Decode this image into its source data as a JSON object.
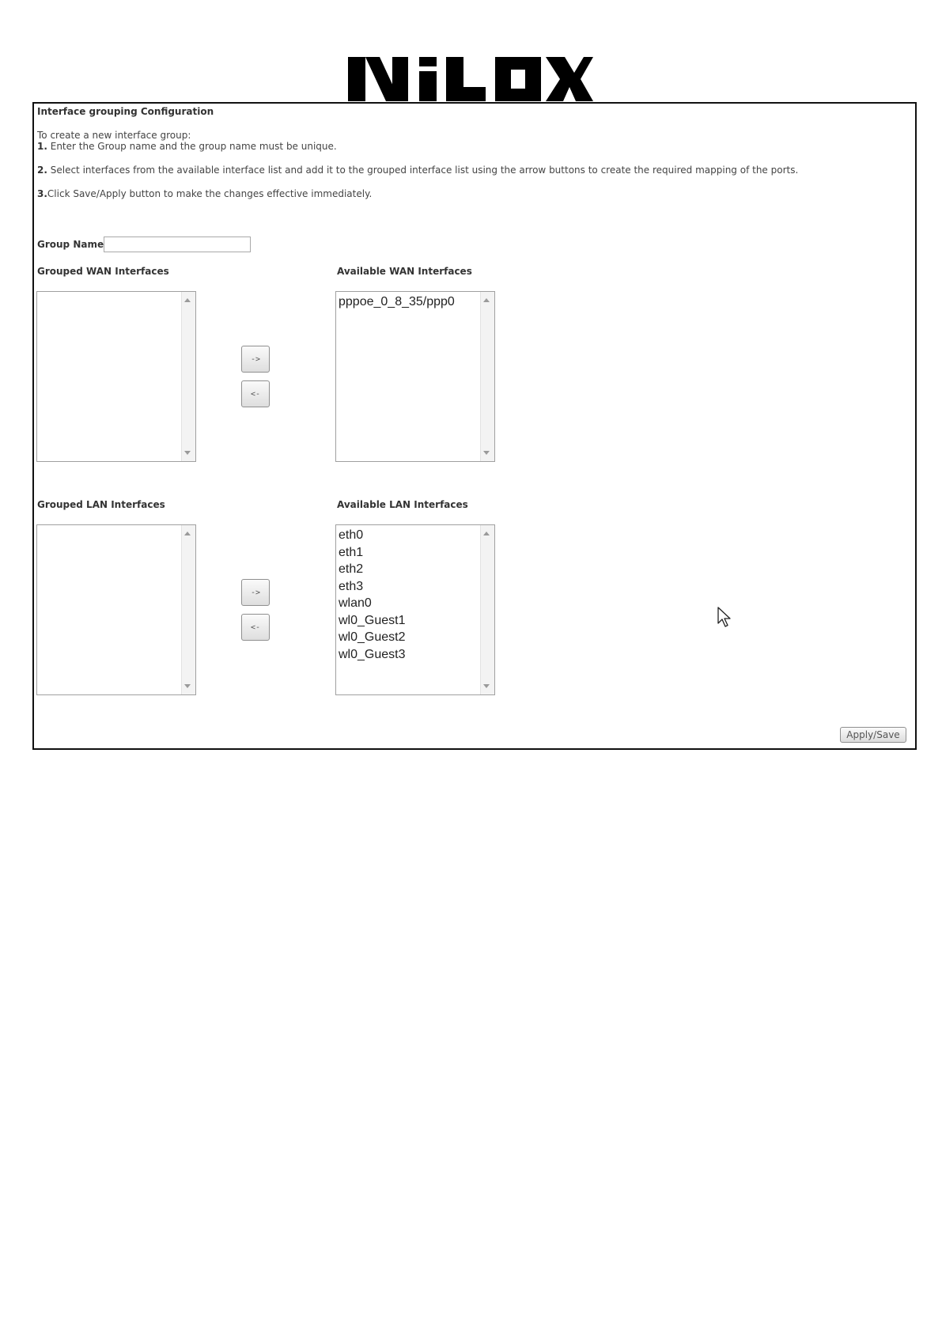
{
  "logo_text": "NILOX",
  "page": {
    "title": "Interface grouping Configuration",
    "intro": "To create a new interface group:",
    "steps": [
      {
        "num": "1.",
        "text": " Enter the Group name and the group name must be unique."
      },
      {
        "num": "2.",
        "text": " Select interfaces from the available interface list and add it to the grouped interface list using the arrow buttons to create the required mapping of the ports."
      },
      {
        "num": "3.",
        "text": "Click Save/Apply button to make the changes effective immediately."
      }
    ],
    "group_name_label": "Group Name:",
    "group_name_value": ""
  },
  "wan": {
    "grouped_label": "Grouped WAN Interfaces",
    "available_label": "Available WAN Interfaces",
    "grouped_items": [],
    "available_items": [
      "pppoe_0_8_35/ppp0"
    ],
    "add_label": "->",
    "remove_label": "<-"
  },
  "lan": {
    "grouped_label": "Grouped LAN Interfaces",
    "available_label": "Available LAN Interfaces",
    "grouped_items": [],
    "available_items": [
      "eth0",
      "eth1",
      "eth2",
      "eth3",
      "wlan0",
      "wl0_Guest1",
      "wl0_Guest2",
      "wl0_Guest3"
    ],
    "add_label": "->",
    "remove_label": "<-"
  },
  "apply_label": "Apply/Save",
  "icons": {
    "cursor": "mouse-pointer-icon",
    "scroll_up": "scroll-up-arrow-icon",
    "scroll_down": "scroll-down-arrow-icon"
  }
}
